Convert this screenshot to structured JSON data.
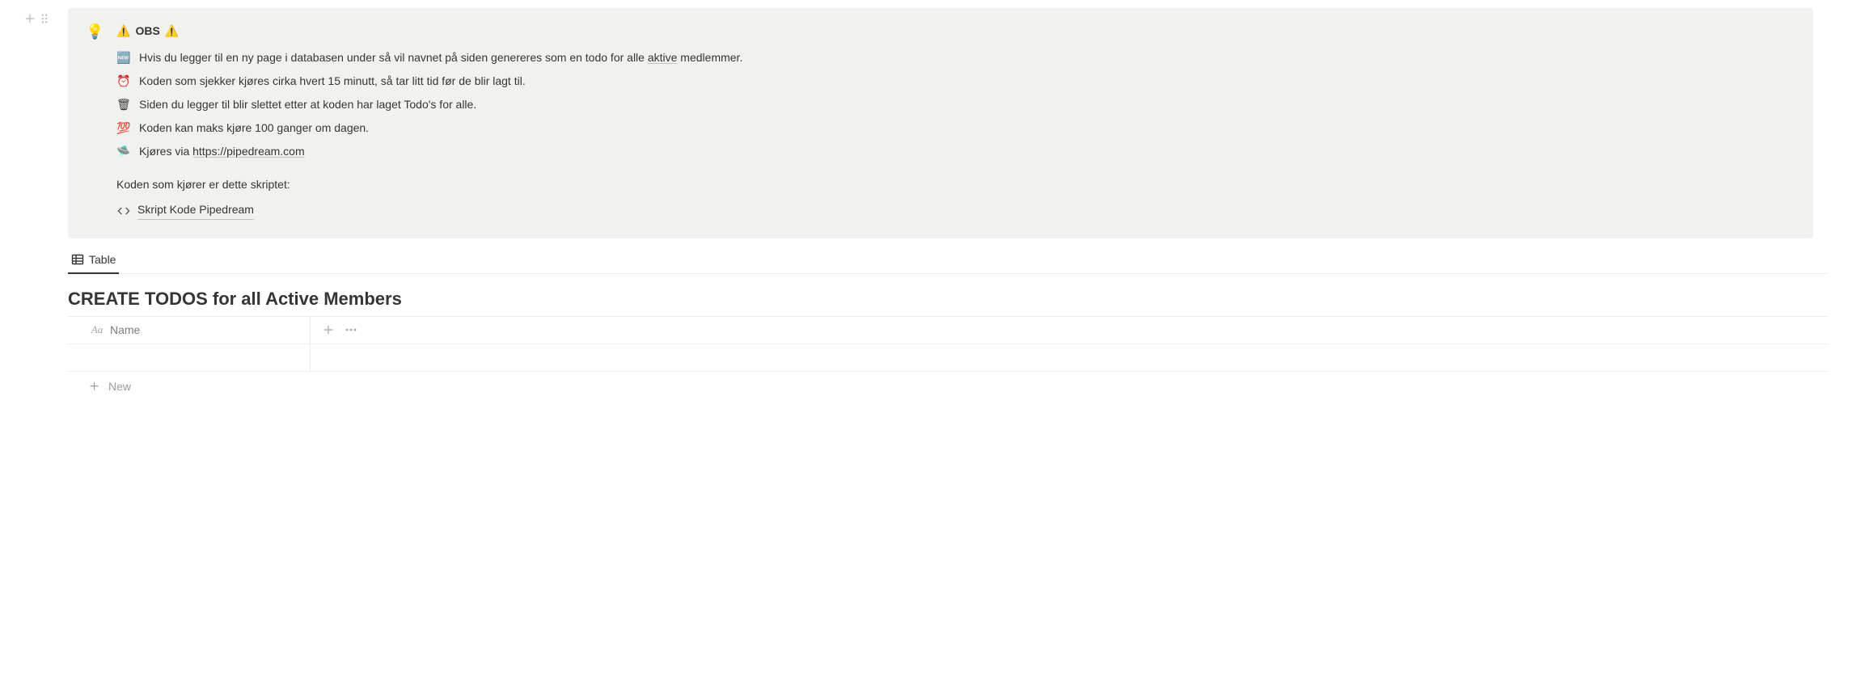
{
  "callout": {
    "icon": "💡",
    "title_prefix": "⚠️",
    "title": "OBS",
    "title_suffix": "⚠️",
    "items": [
      {
        "icon": "🆕",
        "text_before": "Hvis du legger til en ny page i databasen under så vil navnet på siden genereres som en todo for alle ",
        "underlined": "aktive",
        "text_after": " medlemmer."
      },
      {
        "icon": "⏰",
        "text_before": "Koden som sjekker kjøres cirka hvert 15 minutt, så tar litt tid før de blir lagt til.",
        "underlined": "",
        "text_after": ""
      },
      {
        "icon": "🗑",
        "text_before": "Siden du legger til blir slettet etter at koden har laget Todo's for alle.",
        "underlined": "",
        "text_after": ""
      },
      {
        "icon": "💯",
        "text_before": "Koden kan maks kjøre 100 ganger om dagen.",
        "underlined": "",
        "text_after": ""
      },
      {
        "icon": "🛸",
        "text_before": "Kjøres via ",
        "underlined": "https://pipedream.com",
        "text_after": ""
      }
    ],
    "subtext": "Koden som kjører er dette skriptet:",
    "script_link": "Skript Kode Pipedream"
  },
  "db": {
    "view_tab": "Table",
    "title": "CREATE TODOS for all Active Members",
    "col_name": "Name",
    "new_row": "New"
  }
}
